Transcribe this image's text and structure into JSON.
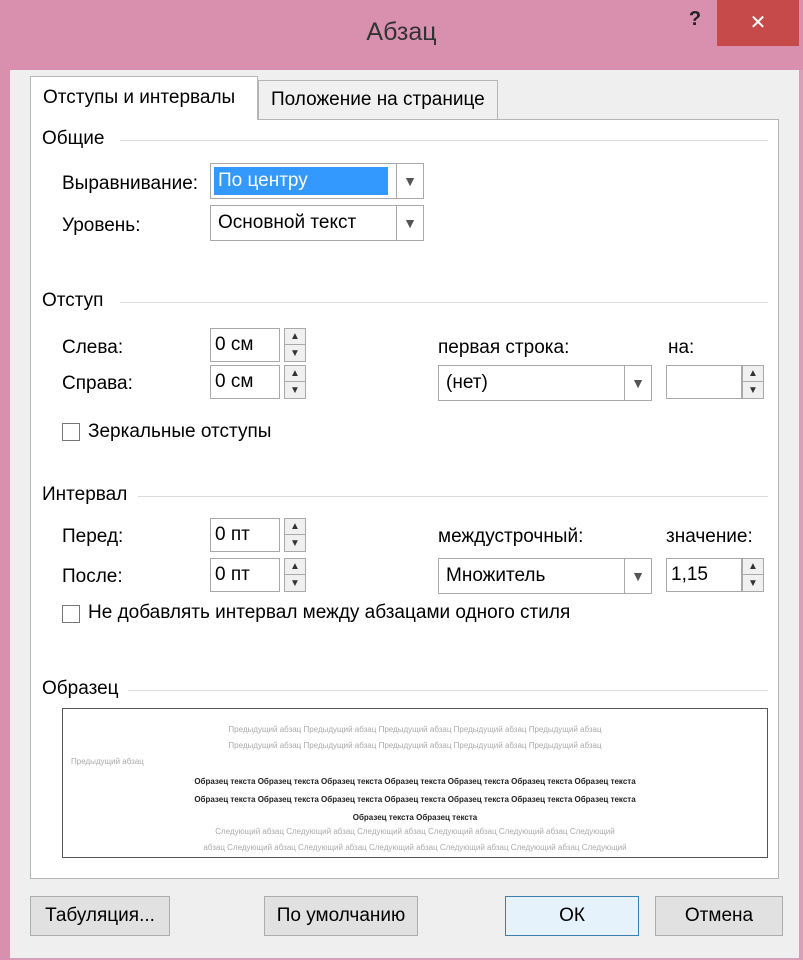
{
  "window": {
    "title": "Абзац",
    "help": "?",
    "close": "✕"
  },
  "tabs": [
    {
      "label": "Отступы и интервалы"
    },
    {
      "label": "Положение на странице"
    }
  ],
  "general": {
    "section": "Общие",
    "alignment_label": "Выравнивание:",
    "alignment_value": "По центру",
    "level_label": "Уровень:",
    "level_value": "Основной текст"
  },
  "indent": {
    "section": "Отступ",
    "left_label": "Слева:",
    "left_value": "0 см",
    "right_label": "Справа:",
    "right_value": "0 см",
    "first_line_label": "первая строка:",
    "first_line_value": "(нет)",
    "by_label": "на:",
    "by_value": "",
    "mirror_label": "Зеркальные отступы"
  },
  "spacing": {
    "section": "Интервал",
    "before_label": "Перед:",
    "before_value": "0 пт",
    "after_label": "После:",
    "after_value": "0 пт",
    "line_label": "междустрочный:",
    "line_value": "Множитель",
    "at_label": "значение:",
    "at_value": "1,15",
    "no_space_label": "Не добавлять интервал между абзацами одного стиля"
  },
  "preview": {
    "section": "Образец",
    "prev_lines": [
      "Предыдущий абзац Предыдущий абзац Предыдущий абзац Предыдущий абзац Предыдущий абзац",
      "Предыдущий абзац Предыдущий абзац Предыдущий абзац Предыдущий абзац Предыдущий абзац",
      "Предыдущий абзац"
    ],
    "sample_lines": [
      "Образец текста Образец текста Образец текста Образец текста Образец текста Образец текста Образец текста",
      "Образец текста Образец текста Образец текста Образец текста Образец текста Образец текста Образец текста",
      "Образец текста Образец текста"
    ],
    "next_lines": [
      "Следующий абзац Следующий абзац Следующий абзац Следующий абзац Следующий абзац Следующий",
      "абзац Следующий абзац Следующий абзац Следующий абзац Следующий абзац Следующий абзац Следующий"
    ]
  },
  "buttons": {
    "tabs": "Табуляция...",
    "default": "По умолчанию",
    "ok": "ОК",
    "cancel": "Отмена"
  }
}
